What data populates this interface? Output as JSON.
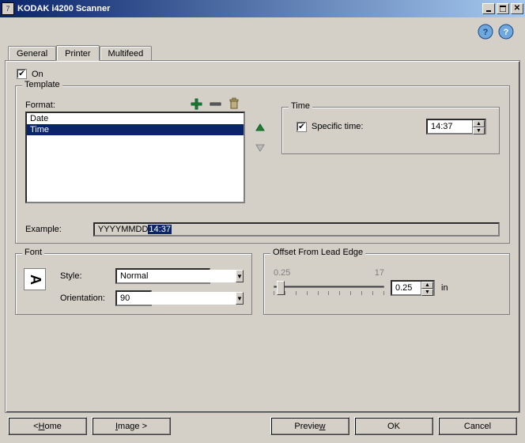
{
  "window": {
    "title": "KODAK i4200 Scanner"
  },
  "tabs": {
    "general": "General",
    "printer": "Printer",
    "multifeed": "Multifeed"
  },
  "on": {
    "label": "On",
    "checked": true
  },
  "template": {
    "legend": "Template",
    "format_label": "Format:",
    "items": [
      "Date",
      "Time"
    ],
    "selected": 1,
    "icons": {
      "add": "add-icon",
      "remove": "remove-icon",
      "delete": "trash-icon",
      "up": "up-arrow-icon",
      "down": "down-arrow-icon"
    },
    "example_label": "Example:",
    "example_prefix": "YYYYMMDD",
    "example_highlight": "14:37"
  },
  "time": {
    "legend": "Time",
    "specific_label": "Specific time:",
    "specific_checked": true,
    "value": "14:37"
  },
  "font": {
    "legend": "Font",
    "glyph": "A",
    "style_label": "Style:",
    "style_value": "Normal",
    "orientation_label": "Orientation:",
    "orientation_value": "90"
  },
  "offset": {
    "legend": "Offset From Lead Edge",
    "min_label": "0.25",
    "max_label": "17",
    "value": "0.25",
    "unit": "in"
  },
  "buttons": {
    "home": "< Home",
    "image": "Image >",
    "preview": "Preview",
    "ok": "OK",
    "cancel": "Cancel"
  }
}
